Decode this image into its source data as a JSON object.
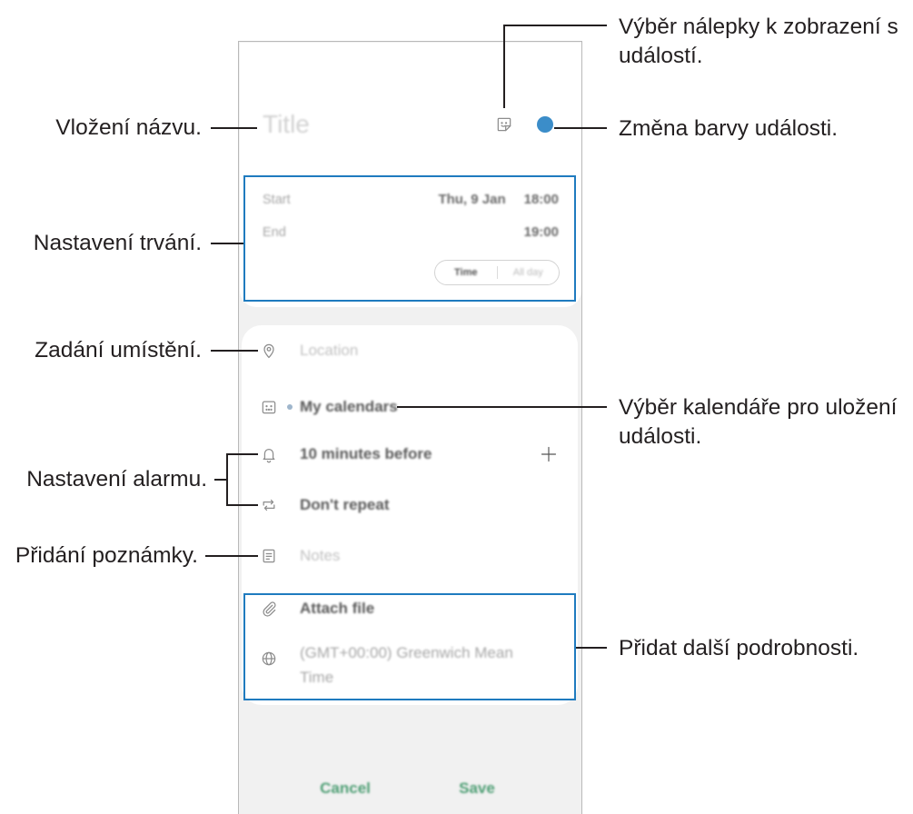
{
  "colors": {
    "annotation_line": "#231f20",
    "annotation_box": "#1f7bbf",
    "event_color": "#3b8dc9",
    "action_text": "#4e9e74"
  },
  "annotations": {
    "sticker": {
      "lines": [
        "Výběr nálepky k zobrazení s",
        "událostí."
      ]
    },
    "title": {
      "text": "Vložení názvu."
    },
    "color": {
      "text": "Změna barvy události."
    },
    "duration": {
      "text": "Nastavení trvání."
    },
    "location": {
      "text": "Zadání umístění."
    },
    "calendar": {
      "lines": [
        "Výběr kalendáře pro uložení",
        "události."
      ]
    },
    "alarm": {
      "text": "Nastavení alarmu."
    },
    "notes": {
      "text": "Přidání poznámky."
    },
    "details": {
      "text": "Přidat další podrobnosti."
    }
  },
  "event_editor": {
    "title_placeholder": "Title",
    "duration": {
      "start_label": "Start",
      "start_date": "Thu, 9 Jan",
      "start_time": "18:00",
      "end_label": "End",
      "end_time": "19:00",
      "mode_options": [
        "Time",
        "All day"
      ]
    },
    "location_placeholder": "Location",
    "calendar": "My calendars",
    "reminder": "10 minutes before",
    "repeat": "Don't repeat",
    "notes_placeholder": "Notes",
    "attach": "Attach file",
    "timezone": "(GMT+00:00) Greenwich Mean Time",
    "actions": {
      "cancel": "Cancel",
      "save": "Save"
    }
  },
  "icons": {
    "sticker": "sticker-icon",
    "location": "map-pin-icon",
    "calendar": "calendar-icon",
    "reminder": "bell-icon",
    "add_reminder": "plus-icon",
    "repeat": "repeat-icon",
    "notes": "notes-icon",
    "attach": "paperclip-icon",
    "timezone": "globe-icon"
  }
}
